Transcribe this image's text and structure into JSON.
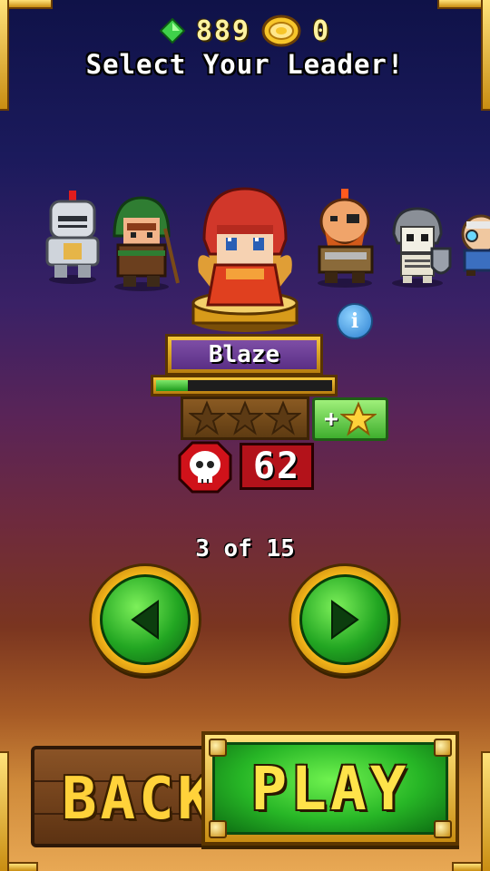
{
  "currency": {
    "gems": "889",
    "coins": "0",
    "gem_icon": "green-gem-icon",
    "coin_icon": "gold-coin-icon"
  },
  "title": "Select Your Leader!",
  "characters": [
    {
      "icon": "knight-character-icon"
    },
    {
      "icon": "ranger-character-icon"
    },
    {
      "icon": "blaze-character-icon",
      "selected": true
    },
    {
      "icon": "pirate-dwarf-character-icon"
    },
    {
      "icon": "skeleton-warrior-character-icon"
    },
    {
      "icon": "goggles-character-icon"
    }
  ],
  "leader": {
    "name": "Blaze",
    "xp_fraction": 0.18,
    "stars_filled": 0,
    "stars_total": 3,
    "add_star_label": "+",
    "kills": "62"
  },
  "pager": {
    "text": "3 of 15"
  },
  "buttons": {
    "back_label": "BACK",
    "play_label": "PLAY"
  },
  "colors": {
    "accent_gold": "#f4b51a",
    "button_green": "#22a622",
    "name_purple": "#6a3d96",
    "kills_red": "#b3121a"
  }
}
